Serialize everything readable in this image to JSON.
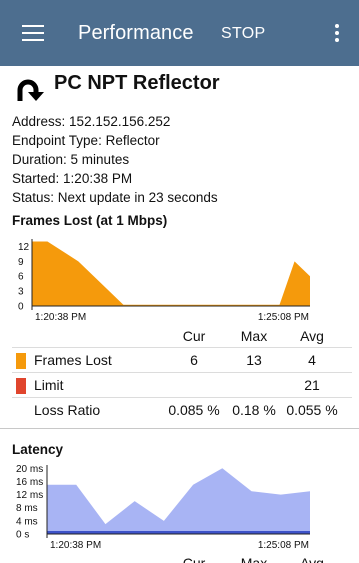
{
  "app_bar": {
    "title": "Performance",
    "stop_label": "STOP",
    "menu_icon": "hamburger-menu-icon",
    "overflow_icon": "more-vert-icon",
    "bg_color": "#4d6e8f"
  },
  "test": {
    "name": "PC NPT Reflector",
    "icon": "u-turn-arrow-icon",
    "details": [
      {
        "label": "Address:",
        "value": "152.152.156.252"
      },
      {
        "label": "Endpoint Type:",
        "value": "Reflector"
      },
      {
        "label": "Duration:",
        "value": "5 minutes"
      },
      {
        "label": "Started:",
        "value": "1:20:38 PM"
      },
      {
        "label": "Status:",
        "value": "Next update in 23 seconds"
      }
    ]
  },
  "frames_chart": {
    "title": "Frames Lost (at 1 Mbps)",
    "color": "#f59a0c",
    "y_ticks": [
      "12",
      "9",
      "6",
      "3",
      "0"
    ],
    "x_start": "1:20:38 PM",
    "x_end": "1:25:08 PM",
    "stats_headers": [
      "Cur",
      "Max",
      "Avg"
    ],
    "rows": [
      {
        "label": "Frames Lost",
        "cur": "6",
        "max": "13",
        "avg": "4",
        "color": "#f59a0c"
      },
      {
        "label": "Limit",
        "cur": "",
        "max": "",
        "avg": "21",
        "color": "#e0452d"
      },
      {
        "label": "Loss Ratio",
        "cur": "0.085 %",
        "max": "0.18 %",
        "avg": "0.055 %",
        "color": ""
      }
    ]
  },
  "latency_chart": {
    "title": "Latency",
    "color": "#a8b4f4",
    "line_color": "#3d53c9",
    "y_ticks": [
      "20 ms",
      "16 ms",
      "12 ms",
      "8 ms",
      "4 ms",
      "0 s"
    ],
    "x_start": "1:20:38 PM",
    "x_end": "1:25:08 PM",
    "stats_headers": [
      "Cur",
      "Max",
      "Avg"
    ]
  },
  "chart_data": [
    {
      "type": "area",
      "title": "Frames Lost (at 1 Mbps)",
      "xlabel": "",
      "ylabel": "",
      "ylim": [
        0,
        13
      ],
      "x_labels": [
        "1:20:38 PM",
        "1:25:08 PM"
      ],
      "series": [
        {
          "name": "Frames Lost",
          "x": [
            0,
            15,
            45,
            90,
            150,
            210,
            240,
            255,
            270
          ],
          "values": [
            13,
            13,
            9,
            0,
            0,
            0,
            0,
            9,
            6
          ]
        }
      ]
    },
    {
      "type": "area",
      "title": "Latency",
      "xlabel": "",
      "ylabel": "",
      "ylim": [
        0,
        20
      ],
      "x_labels": [
        "1:20:38 PM",
        "1:25:08 PM"
      ],
      "series": [
        {
          "name": "Latency",
          "x": [
            0,
            30,
            60,
            90,
            120,
            150,
            180,
            210,
            240,
            270
          ],
          "values": [
            15,
            15,
            3,
            10,
            4,
            15,
            20,
            13,
            12,
            13
          ]
        }
      ]
    }
  ]
}
